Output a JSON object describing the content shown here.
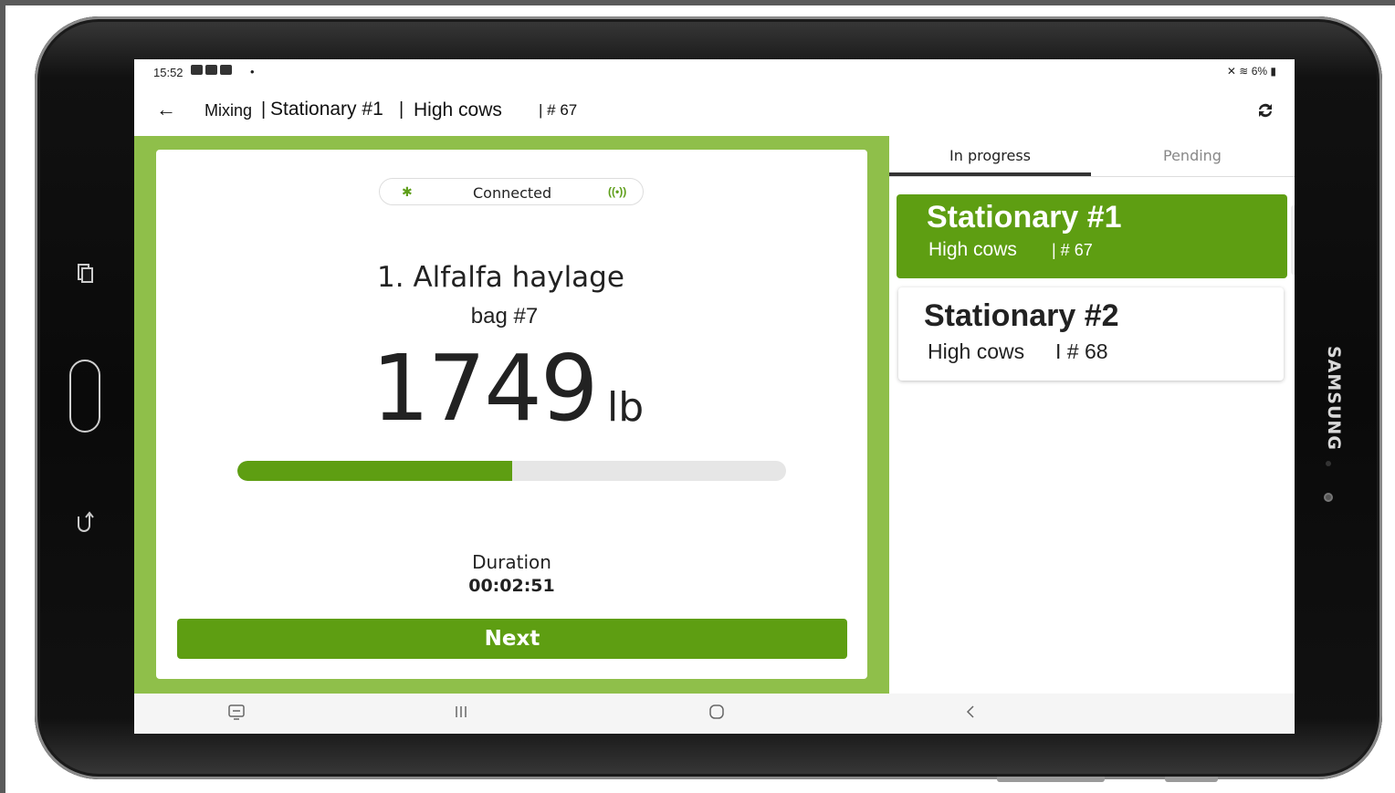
{
  "status_bar": {
    "time": "15:52",
    "dot": "•",
    "right": "6%"
  },
  "app_bar": {
    "mode": "Mixing",
    "separator": "|",
    "station": "Stationary #1",
    "group": "High cows",
    "number": "| # 67",
    "back_icon": "arrow-left-icon",
    "sync_icon": "sync-icon"
  },
  "scale": {
    "connection_status": "Connected",
    "ingredient": "1. Alfalfa haylage",
    "bag": "bag #7",
    "weight": "1749",
    "unit": "lb",
    "progress": 0.5,
    "duration_label": "Duration",
    "duration_value": "00:02:51",
    "next_label": "Next"
  },
  "tabs": [
    {
      "label": "In progress",
      "active": true
    },
    {
      "label": "Pending",
      "active": false
    }
  ],
  "mixes": [
    {
      "title": "Stationary #1",
      "group": "High cows",
      "number": "| # 67",
      "selected": true
    },
    {
      "title": "Stationary #2",
      "group": "High cows",
      "number": "I # 68",
      "selected": false
    }
  ],
  "device": {
    "brand": "SAMSUNG"
  },
  "colors": {
    "accent": "#5e9e12",
    "frame": "#8fbf4a"
  }
}
